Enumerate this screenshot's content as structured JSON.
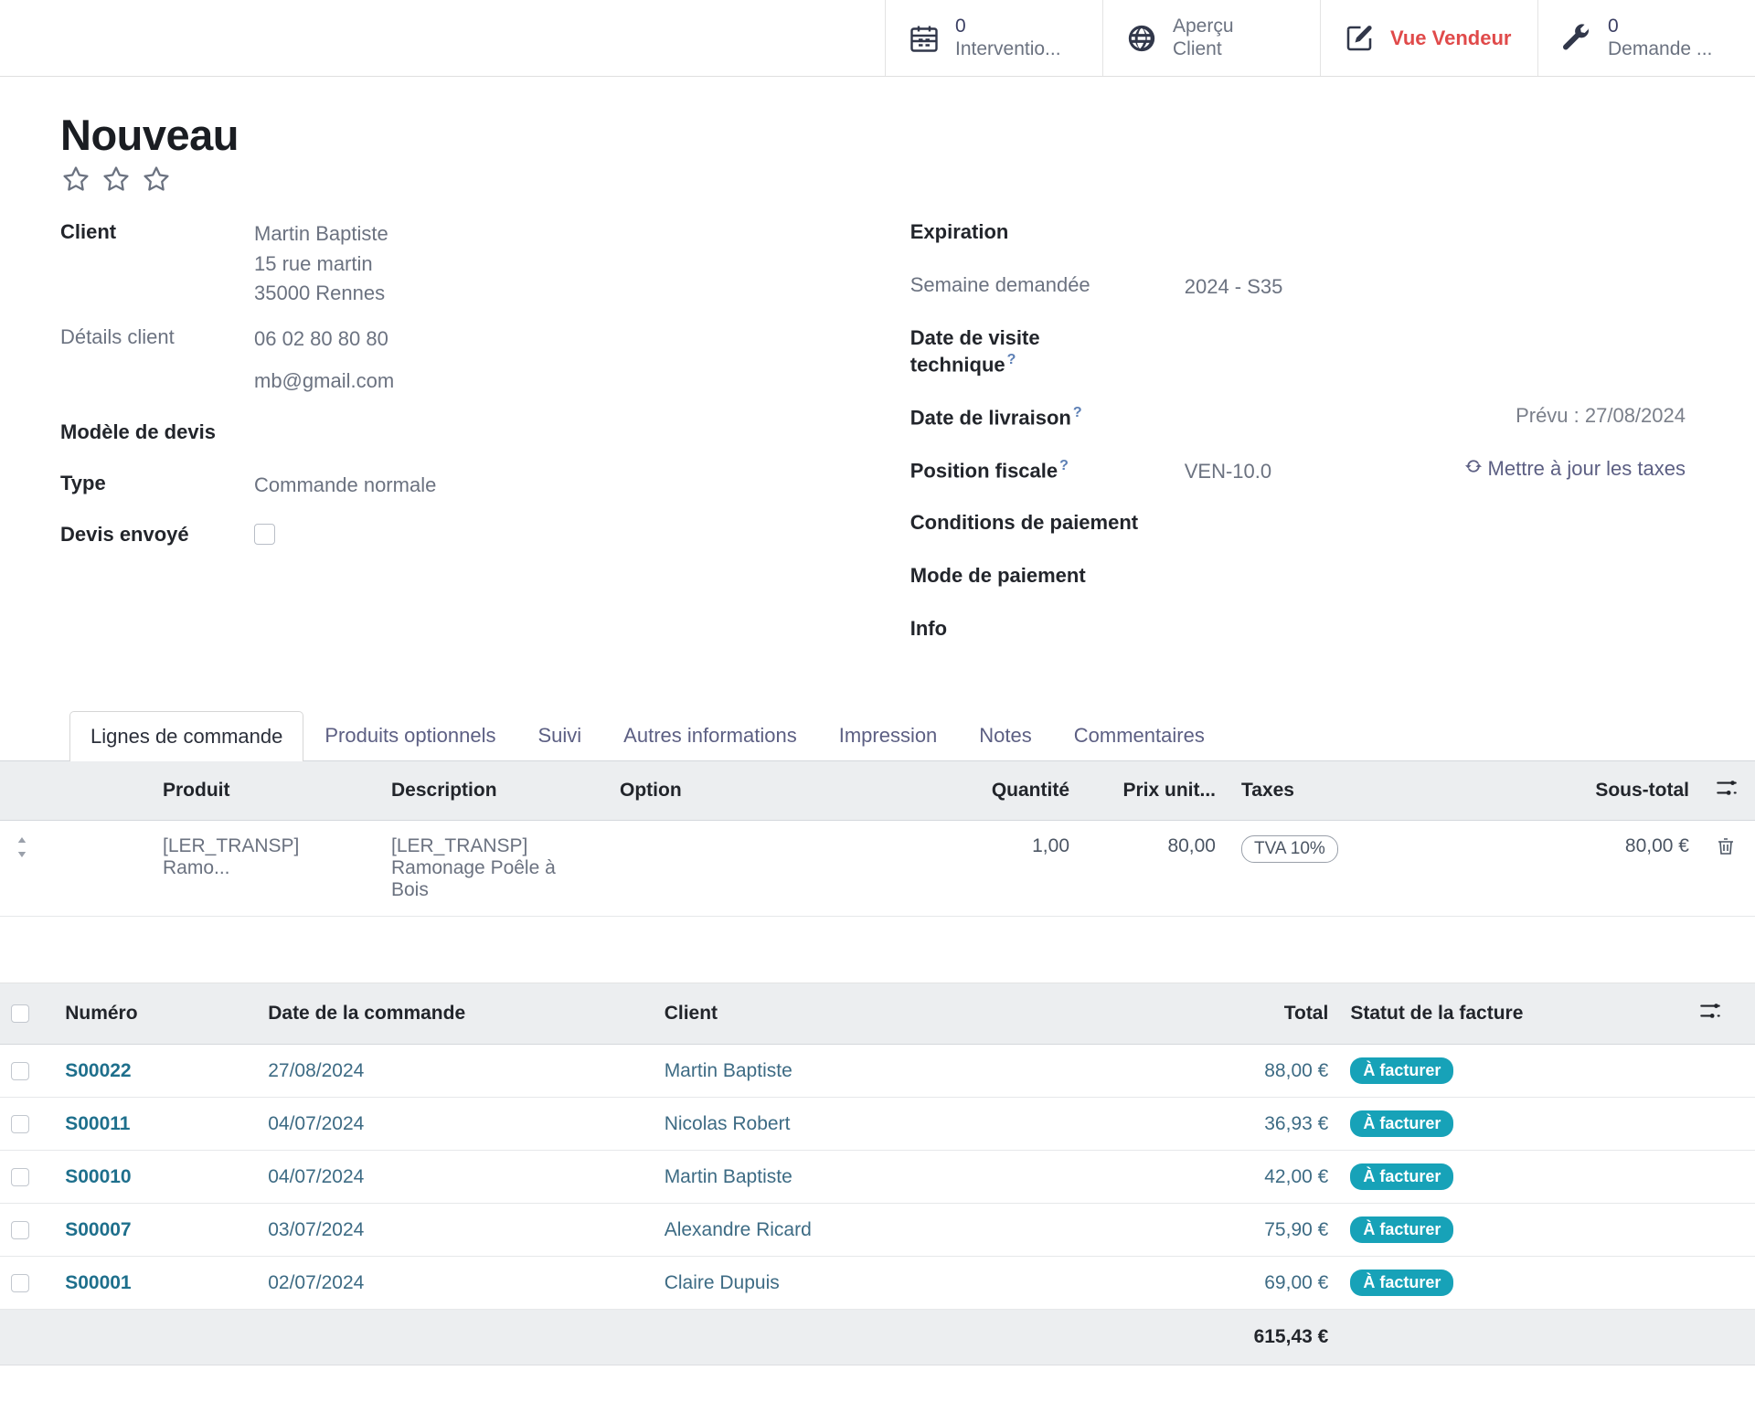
{
  "statbar": {
    "buttons": [
      {
        "icon": "calendar-icon",
        "count": "0",
        "label": "Interventio...",
        "accent": false
      },
      {
        "icon": "globe-icon",
        "count": "",
        "label_line1": "Aperçu",
        "label_line2": "Client",
        "accent": false
      },
      {
        "icon": "pencil-square-icon",
        "count": "",
        "label": "Vue Vendeur",
        "accent": true
      },
      {
        "icon": "wrench-icon",
        "count": "0",
        "label": "Demande ...",
        "accent": false
      }
    ]
  },
  "record": {
    "title": "Nouveau",
    "priority_stars": 3,
    "priority_filled": 0
  },
  "form_left": {
    "client_label": "Client",
    "client_name": "Martin Baptiste",
    "client_street": "15 rue martin",
    "client_city": "35000 Rennes",
    "details_label": "Détails client",
    "details_phone": "06 02 80 80 80",
    "details_email": "mb@gmail.com",
    "template_label": "Modèle de devis",
    "template_value": "",
    "type_label": "Type",
    "type_value": "Commande normale",
    "sent_label": "Devis envoyé",
    "sent_checked": false
  },
  "form_right": {
    "expiration_label": "Expiration",
    "expiration_value": "",
    "week_label": "Semaine demandée",
    "week_value": "2024 - S35",
    "visit_label_l1": "Date de visite",
    "visit_label_l2": "technique",
    "visit_value": "",
    "delivery_label": "Date de livraison",
    "delivery_value": "",
    "delivery_trailing": "Prévu : 27/08/2024",
    "fiscal_label": "Position fiscale",
    "fiscal_value": "VEN-10.0",
    "update_taxes_link": "Mettre à jour les taxes",
    "payment_terms_label": "Conditions de paiement",
    "payment_terms_value": "",
    "payment_mode_label": "Mode de paiement",
    "payment_mode_value": "",
    "info_label": "Info",
    "info_value": ""
  },
  "tabs": [
    {
      "label": "Lignes de commande",
      "active": true
    },
    {
      "label": "Produits optionnels",
      "active": false
    },
    {
      "label": "Suivi",
      "active": false
    },
    {
      "label": "Autres informations",
      "active": false
    },
    {
      "label": "Impression",
      "active": false
    },
    {
      "label": "Notes",
      "active": false
    },
    {
      "label": "Commentaires",
      "active": false
    }
  ],
  "order_lines": {
    "columns": {
      "product": "Produit",
      "description": "Description",
      "option": "Option",
      "quantity": "Quantité",
      "unit_price": "Prix unit...",
      "taxes": "Taxes",
      "subtotal": "Sous-total"
    },
    "rows": [
      {
        "product": "[LER_TRANSP] Ramo...",
        "description_line1": "[LER_TRANSP]",
        "description_line2": "Ramonage Poêle à Bois",
        "option": "",
        "quantity": "1,00",
        "unit_price": "80,00",
        "tax_tag": "TVA 10%",
        "subtotal": "80,00 €"
      }
    ]
  },
  "order_list": {
    "columns": {
      "numero": "Numéro",
      "date": "Date de la commande",
      "client": "Client",
      "total": "Total",
      "status": "Statut de la facture"
    },
    "rows": [
      {
        "numero": "S00022",
        "date": "27/08/2024",
        "client": "Martin Baptiste",
        "total": "88,00 €",
        "status": "À facturer"
      },
      {
        "numero": "S00011",
        "date": "04/07/2024",
        "client": "Nicolas Robert",
        "total": "36,93 €",
        "status": "À facturer"
      },
      {
        "numero": "S00010",
        "date": "04/07/2024",
        "client": "Martin Baptiste",
        "total": "42,00 €",
        "status": "À facturer"
      },
      {
        "numero": "S00007",
        "date": "03/07/2024",
        "client": "Alexandre Ricard",
        "total": "75,90 €",
        "status": "À facturer"
      },
      {
        "numero": "S00001",
        "date": "02/07/2024",
        "client": "Claire Dupuis",
        "total": "69,00 €",
        "status": "À facturer"
      }
    ],
    "footer_total": "615,43 €"
  },
  "colors": {
    "accent_red": "#e04a4a",
    "badge_teal": "#17a2b8",
    "link_blue": "#1e6f8c",
    "link_purple": "#5c5f83",
    "header_grey": "#eceef0"
  }
}
